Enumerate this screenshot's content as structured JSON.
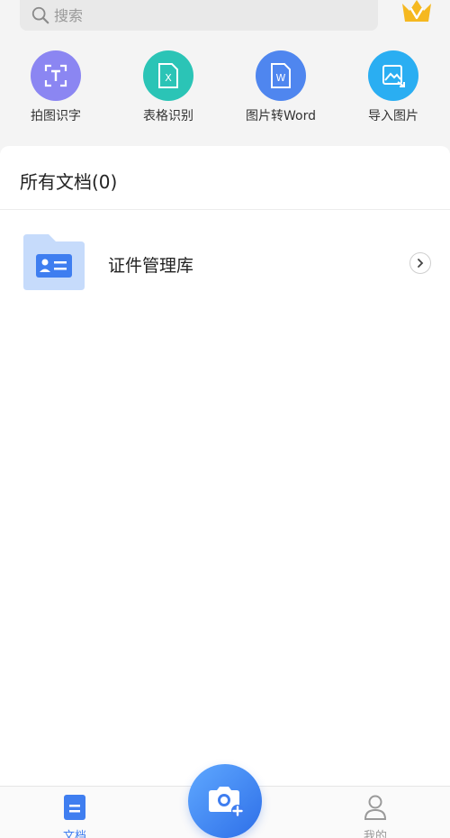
{
  "search": {
    "placeholder": "搜索"
  },
  "tools": [
    {
      "label": "拍图识字",
      "color": "#8b86f2",
      "icon": "text-scan-icon"
    },
    {
      "label": "表格识别",
      "color": "#2bc4b6",
      "icon": "excel-icon"
    },
    {
      "label": "图片转Word",
      "color": "#4f86ef",
      "icon": "word-icon"
    },
    {
      "label": "导入图片",
      "color": "#2aaef2",
      "icon": "image-import-icon"
    }
  ],
  "documents": {
    "title": "所有文档(0)",
    "folders": [
      {
        "name": "证件管理库",
        "icon": "id-card-folder-icon"
      }
    ]
  },
  "bottom_nav": {
    "docs_label": "文档",
    "mine_label": "我的"
  },
  "colors": {
    "accent": "#3f7ef0",
    "vip_gold": "#f5b820"
  }
}
